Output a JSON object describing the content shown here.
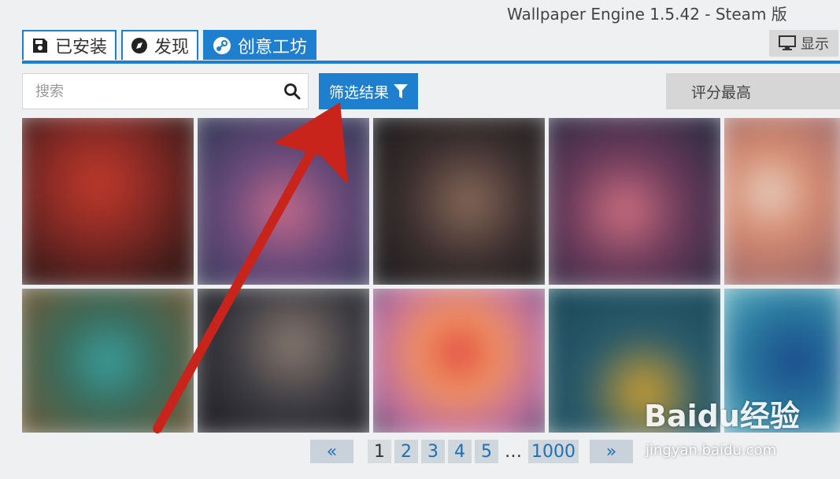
{
  "window": {
    "title": "Wallpaper Engine 1.5.42 - Steam 版"
  },
  "header": {
    "display_label": "显示",
    "display_icon": "monitor-icon"
  },
  "tabs": [
    {
      "label": "已安装",
      "icon": "save-icon",
      "active": false
    },
    {
      "label": "发现",
      "icon": "compass-icon",
      "active": false
    },
    {
      "label": "创意工坊",
      "icon": "steam-icon",
      "active": true
    }
  ],
  "toolbar": {
    "search_placeholder": "搜索",
    "filter_label": "筛选结果",
    "sort_label": "评分最高"
  },
  "pagination": {
    "first_label": "«",
    "last_label": "»",
    "pages": [
      "1",
      "2",
      "3",
      "4",
      "5"
    ],
    "ellipsis": "…",
    "last_page": "1000",
    "current": "1"
  },
  "watermark": {
    "logo": "Baidu经验",
    "url": "jingyan.baidu.com"
  },
  "colors": {
    "accent": "#1e7fcf",
    "annotation_arrow": "#c8241b"
  }
}
